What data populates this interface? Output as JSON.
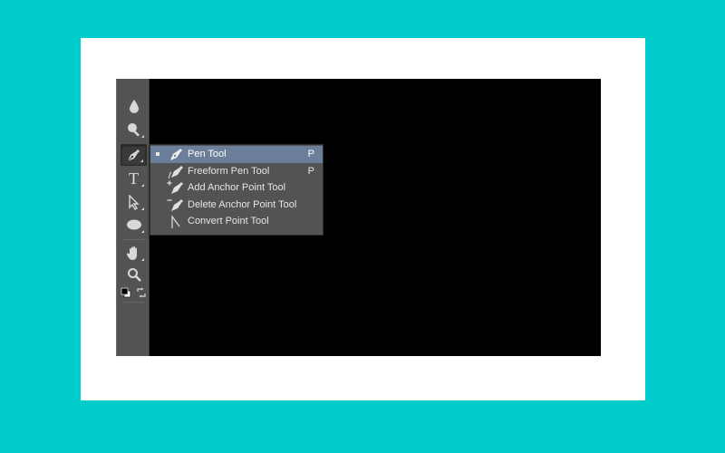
{
  "colors": {
    "background": "#00cccc",
    "frame": "#ffffff",
    "canvas": "#000000",
    "toolbar": "#535353",
    "menu_highlight": "#6c7f9a",
    "menu_text": "#e6e6e6"
  },
  "toolbar": {
    "tools": [
      {
        "name": "blur-tool",
        "icon": "droplet-icon"
      },
      {
        "name": "dodge-tool",
        "icon": "dodge-icon"
      },
      {
        "name": "pen-tool",
        "icon": "pen-icon",
        "active": true
      },
      {
        "name": "type-tool",
        "icon": "type-icon",
        "glyph": "T"
      },
      {
        "name": "path-selection-tool",
        "icon": "arrow-cursor-icon"
      },
      {
        "name": "ellipse-tool",
        "icon": "ellipse-icon"
      },
      {
        "name": "hand-tool",
        "icon": "hand-icon"
      },
      {
        "name": "zoom-tool",
        "icon": "magnifier-icon"
      },
      {
        "name": "default-colors",
        "icon": "default-colors-icon"
      },
      {
        "name": "swap-colors",
        "icon": "swap-arrow-icon"
      }
    ]
  },
  "flyout": {
    "items": [
      {
        "label": "Pen Tool",
        "shortcut": "P",
        "selected": true,
        "icon": "pen-icon"
      },
      {
        "label": "Freeform Pen Tool",
        "shortcut": "P",
        "selected": false,
        "icon": "freeform-pen-icon"
      },
      {
        "label": "Add Anchor Point Tool",
        "shortcut": "",
        "selected": false,
        "icon": "add-anchor-icon"
      },
      {
        "label": "Delete Anchor Point Tool",
        "shortcut": "",
        "selected": false,
        "icon": "delete-anchor-icon"
      },
      {
        "label": "Convert Point Tool",
        "shortcut": "",
        "selected": false,
        "icon": "convert-point-icon"
      }
    ]
  }
}
